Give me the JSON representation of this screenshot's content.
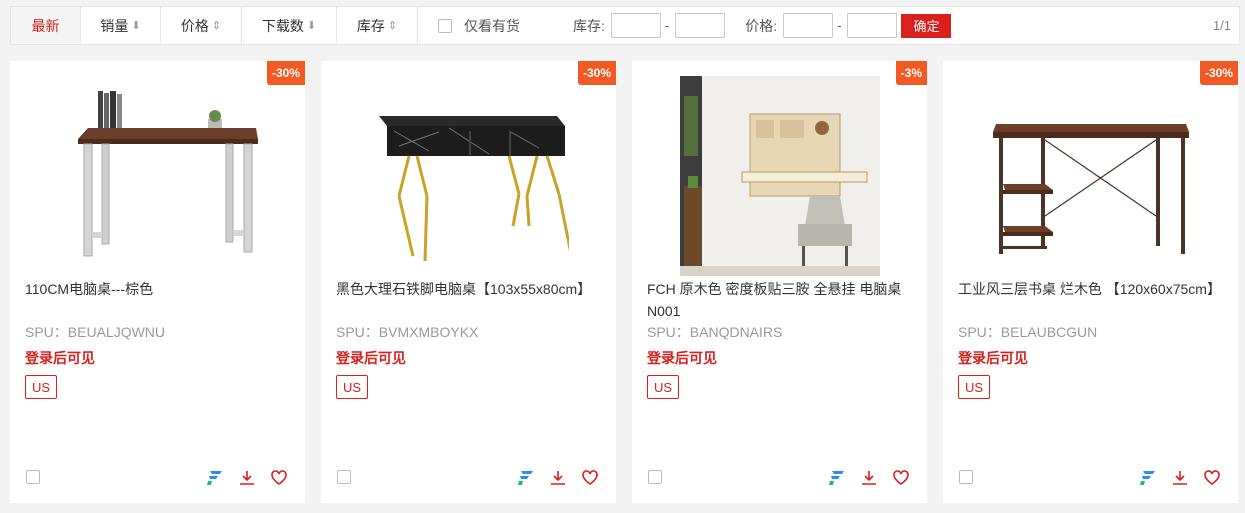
{
  "sort_bar": {
    "newest": "最新",
    "sales": "销量",
    "price": "价格",
    "downloads": "下载数",
    "stock": "库存"
  },
  "filters": {
    "in_stock_only": "仅看有货",
    "stock_label": "库存:",
    "price_label": "价格:",
    "dash": "-",
    "confirm": "确定"
  },
  "pager": "1/1",
  "colors": {
    "accent": "#d9201b",
    "discount_bg": "#f15a22",
    "brand_icon": "#2d8cf0"
  },
  "products": [
    {
      "discount": "-30%",
      "title": "110CM电脑桌---棕色",
      "spu": "SPU：BEUALJQWNU",
      "login": "登录后可见",
      "tag": "US"
    },
    {
      "discount": "-30%",
      "title": "黑色大理石铁脚电脑桌【103x55x80cm】",
      "spu": "SPU：BVMXMBOYKX",
      "login": "登录后可见",
      "tag": "US"
    },
    {
      "discount": "-3%",
      "title": "FCH 原木色 密度板贴三胺 全悬挂 电脑桌 N001",
      "spu": "SPU：BANQDNAIRS",
      "login": "登录后可见",
      "tag": "US"
    },
    {
      "discount": "-30%",
      "title": "工业风三层书桌 烂木色 【120x60x75cm】",
      "spu": "SPU：BELAUBCGUN",
      "login": "登录后可见",
      "tag": "US"
    }
  ]
}
